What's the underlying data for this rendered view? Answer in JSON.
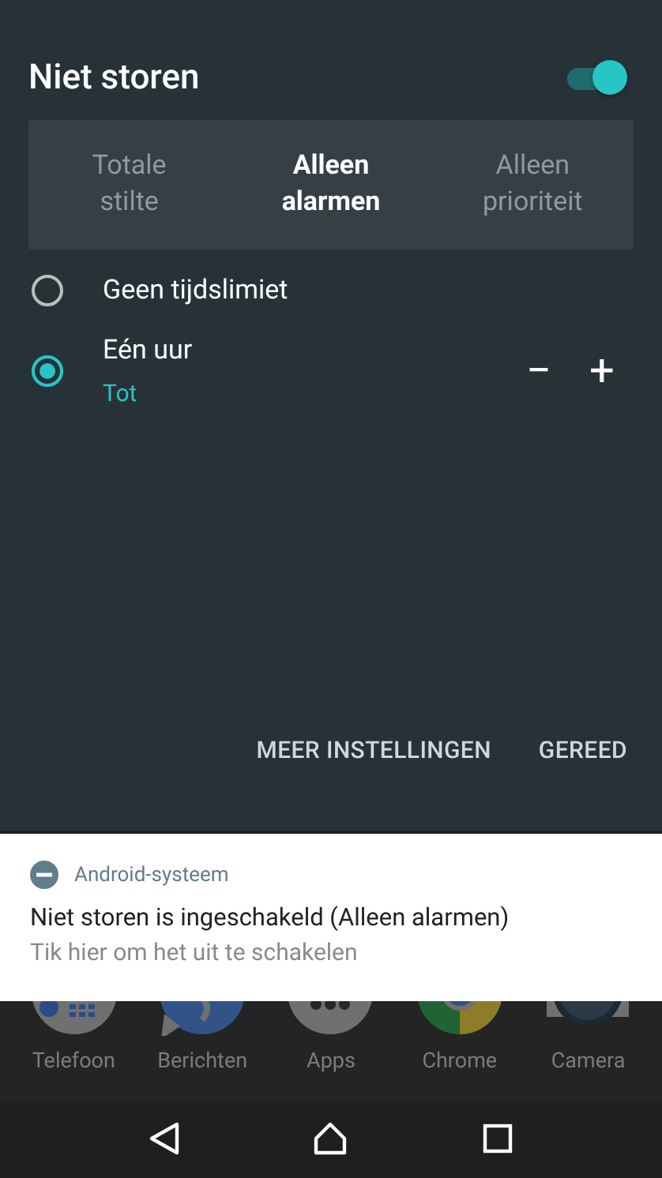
{
  "header": {
    "title": "Niet storen",
    "switch_on": true
  },
  "modes": [
    {
      "label": "Totale stilte",
      "selected": false
    },
    {
      "label": "Alleen alarmen",
      "selected": true
    },
    {
      "label": "Alleen prioriteit",
      "selected": false
    }
  ],
  "durations": [
    {
      "label": "Geen tijdslimiet",
      "selected": false
    },
    {
      "label": "Eén uur",
      "selected": true,
      "sublabel": "Tot",
      "stepper": [
        "−",
        "+"
      ]
    }
  ],
  "actions": [
    "MEER INSTELLINGEN",
    "GEREED"
  ],
  "notification": {
    "app": "Android-systeem",
    "title": "Niet storen is ingeschakeld (Alleen alarmen)",
    "text": "Tik hier om het uit te schakelen"
  },
  "dock": [
    {
      "label": "Telefoon",
      "kind": "phone"
    },
    {
      "label": "Berichten",
      "kind": "messages"
    },
    {
      "label": "Apps",
      "kind": "apps"
    },
    {
      "label": "Chrome",
      "kind": "browser"
    },
    {
      "label": "Camera",
      "kind": "camera"
    }
  ]
}
